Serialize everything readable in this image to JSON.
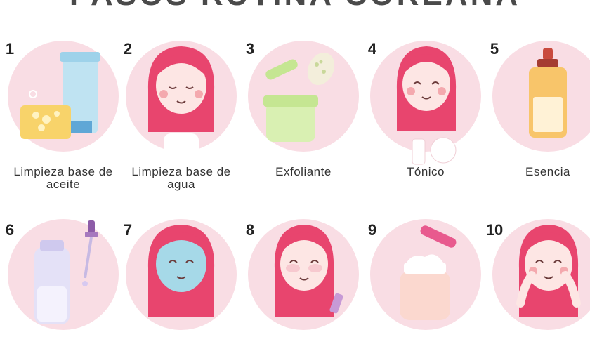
{
  "header": {
    "title": "PASOS RUTINA COREANA"
  },
  "steps": [
    {
      "number": "1",
      "label": "Limpieza base de aceite",
      "icon": "oil-cleanser-icon"
    },
    {
      "number": "2",
      "label": "Limpieza base de agua",
      "icon": "girl-face-wash-icon"
    },
    {
      "number": "3",
      "label": "Exfoliante",
      "icon": "exfoliant-jar-icon"
    },
    {
      "number": "4",
      "label": "Tónico",
      "icon": "girl-toner-icon"
    },
    {
      "number": "5",
      "label": "Esencia",
      "icon": "essence-bottle-icon"
    },
    {
      "number": "6",
      "label": "",
      "icon": "serum-bottle-icon"
    },
    {
      "number": "7",
      "label": "",
      "icon": "girl-sheet-mask-icon"
    },
    {
      "number": "8",
      "label": "",
      "icon": "girl-eye-cream-icon"
    },
    {
      "number": "9",
      "label": "",
      "icon": "moisturizer-jar-icon"
    },
    {
      "number": "10",
      "label": "",
      "icon": "girl-face-massage-icon"
    }
  ],
  "colors": {
    "circle": "#f9dde4",
    "hair": "#e8456e",
    "skin": "#fde6e4",
    "text": "#333333"
  }
}
